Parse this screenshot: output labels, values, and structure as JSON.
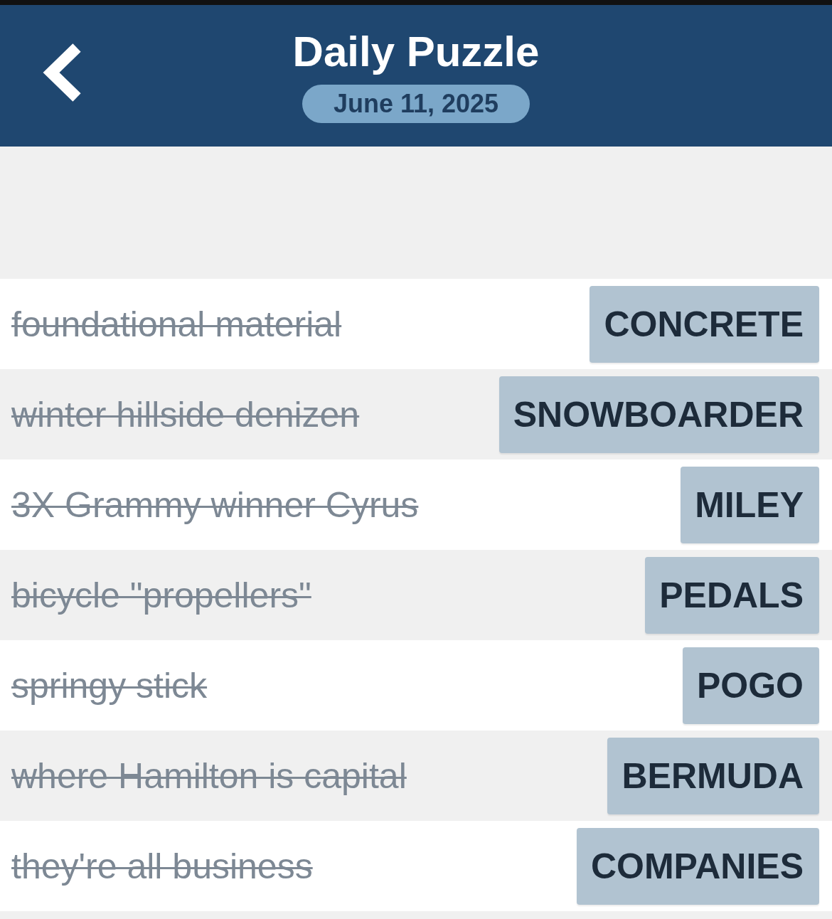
{
  "header": {
    "title": "Daily Puzzle",
    "date": "June 11, 2025"
  },
  "clues": [
    {
      "clue": "foundational material",
      "answer": "CONCRETE",
      "solved": true
    },
    {
      "clue": "winter hillside denizen",
      "answer": "SNOWBOARDER",
      "solved": true
    },
    {
      "clue": "3X Grammy winner Cyrus",
      "answer": "MILEY",
      "solved": true
    },
    {
      "clue": "bicycle \"propellers\"",
      "answer": "PEDALS",
      "solved": true
    },
    {
      "clue": "springy stick",
      "answer": "POGO",
      "solved": true
    },
    {
      "clue": "where Hamilton is capital",
      "answer": "BERMUDA",
      "solved": true
    },
    {
      "clue": "they're all business",
      "answer": "COMPANIES",
      "solved": true
    }
  ]
}
